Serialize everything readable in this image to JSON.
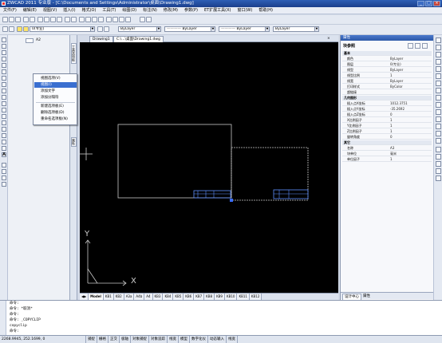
{
  "title": "ZWCAD 2011 专业版 - [C:\\Documents and Settings\\Administrator\\桌面\\Drawing1.dwg]",
  "menu": [
    "文件(F)",
    "编辑(E)",
    "视图(V)",
    "插入(I)",
    "格式(O)",
    "工具(T)",
    "绘图(D)",
    "标注(N)",
    "修改(M)",
    "参数(P)",
    "ET扩展工具(X)",
    "窗口(W)",
    "帮助(H)"
  ],
  "toolbar": {
    "layer_value": "0(专业)",
    "bylayer_1": "ByLayer",
    "bylayer_2": "ByLayer",
    "bylayer_3": "ByLayer",
    "bylayer_4": "ByLayer"
  },
  "palette": {
    "item_label": "A2",
    "side_tabs": [
      "工具选项板",
      "属性"
    ]
  },
  "doctabs": [
    "Drawing1",
    "C:\\...\\桌面\\Drawing1.dwg"
  ],
  "context_menu": {
    "items": [
      "视图选项(V)",
      "视图(I)",
      "添加文字",
      "添加分隔符",
      "新建选项板(E)",
      "删除选项板(D)",
      "重命名选项板(N)"
    ],
    "active_index": 1
  },
  "canvas": {
    "ucs_x": "X",
    "ucs_y": "Y"
  },
  "layout_tabs": [
    "Model",
    "KB1",
    "KB2",
    "A3a",
    "A4b",
    "A4",
    "KB3",
    "KB4",
    "KB5",
    "KB6",
    "KB7",
    "KB8",
    "KB9",
    "KB10",
    "KB11",
    "KB12"
  ],
  "properties": {
    "title": "属性",
    "object_type": "块参照",
    "rows": [
      {
        "k": "基本",
        "v": "",
        "sec": true
      },
      {
        "k": "颜色",
        "v": "ByLayer"
      },
      {
        "k": "图层",
        "v": "0(专业)"
      },
      {
        "k": "线型",
        "v": "ByLayer"
      },
      {
        "k": "线型比例",
        "v": "1"
      },
      {
        "k": "线宽",
        "v": "ByLayer"
      },
      {
        "k": "打印样式",
        "v": "ByColor"
      },
      {
        "k": "超链接",
        "v": ""
      },
      {
        "k": "几何图形",
        "v": "",
        "sec": true
      },
      {
        "k": "插入点X坐标",
        "v": "1012.3751"
      },
      {
        "k": "插入点Y坐标",
        "v": "-35.2692"
      },
      {
        "k": "插入点Z坐标",
        "v": "0"
      },
      {
        "k": "X比例因子",
        "v": "1"
      },
      {
        "k": "Y比例因子",
        "v": "1"
      },
      {
        "k": "Z比例因子",
        "v": "1"
      },
      {
        "k": "旋转角度",
        "v": "0"
      },
      {
        "k": "其它",
        "v": "",
        "sec": true
      },
      {
        "k": "名称",
        "v": "A3"
      },
      {
        "k": "块单位",
        "v": "毫米"
      },
      {
        "k": "单位因子",
        "v": "1"
      }
    ],
    "bottom_tabs": [
      "设计中心",
      "属性"
    ]
  },
  "command": {
    "lines": [
      "命令:",
      "命令: *取消*",
      "命令:",
      "命令: _COPYCLIP",
      "copyclip",
      "命令:"
    ]
  },
  "status": {
    "coords": "2268.9945, 252.1699, 0",
    "buttons": [
      "捕捉",
      "栅格",
      "正交",
      "极轴",
      "对象捕捉",
      "对象追踪",
      "线宽",
      "模型",
      "数字化仪",
      "动态输入",
      "线宽"
    ]
  }
}
